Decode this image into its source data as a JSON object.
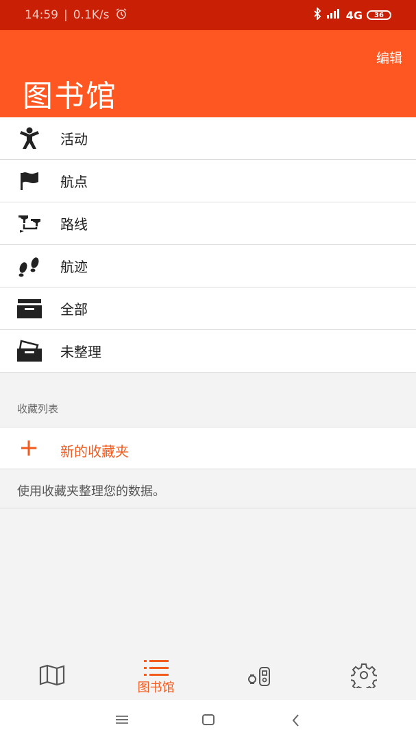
{
  "status_bar": {
    "time": "14:59",
    "separator": "|",
    "speed": "0.1K/s",
    "network": "4G",
    "battery": "36"
  },
  "header": {
    "edit_label": "编辑",
    "title": "图书馆"
  },
  "list": {
    "items": [
      {
        "label": "活动",
        "icon": "person-icon"
      },
      {
        "label": "航点",
        "icon": "flag-icon"
      },
      {
        "label": "路线",
        "icon": "route-pins-icon"
      },
      {
        "label": "航迹",
        "icon": "footprints-icon"
      },
      {
        "label": "全部",
        "icon": "drawer-icon"
      },
      {
        "label": "未整理",
        "icon": "drawer-open-icon"
      }
    ]
  },
  "collections": {
    "section_title": "收藏列表",
    "new_folder_label": "新的收藏夹",
    "hint": "使用收藏夹整理您的数据。"
  },
  "bottom_nav": {
    "active_label": "图书馆",
    "items": [
      "map-icon",
      "list-icon",
      "devices-icon",
      "gear-icon"
    ]
  },
  "colors": {
    "status_bar": "#c81f05",
    "header": "#ff5722",
    "accent": "#f25a1e"
  }
}
